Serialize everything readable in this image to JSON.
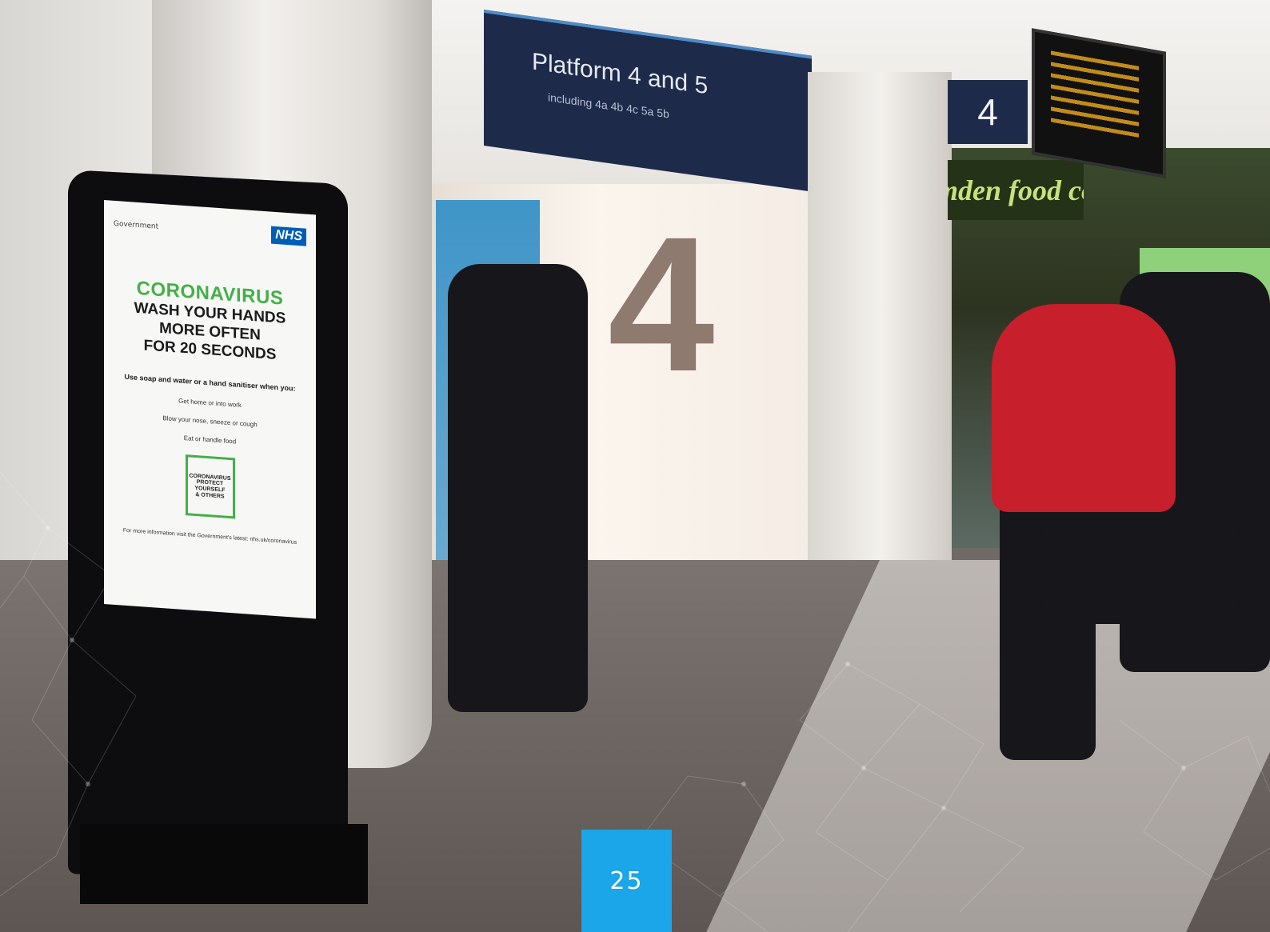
{
  "photo": {
    "platform_sign": {
      "title": "Platform 4 and 5",
      "subtitle": "including 4a 4b 4c 5a 5b"
    },
    "wall_number": "4",
    "platform_box_number": "4",
    "shop_sign": "mden food co"
  },
  "kiosk_screen": {
    "gov_mark": "Government",
    "nhs_logo": "NHS",
    "title": "CORONAVIRUS",
    "headline": [
      "WASH YOUR HANDS",
      "MORE OFTEN",
      "FOR 20 SECONDS"
    ],
    "use_soap": "Use soap and water or a hand sanitiser when you:",
    "when_items": [
      "Get home or into work",
      "Blow your nose, sneeze or cough",
      "Eat or handle food"
    ],
    "protect_lines": [
      "CORONAVIRUS",
      "PROTECT",
      "YOURSELF",
      "& OTHERS"
    ],
    "footer_note": "For more information visit the Government's latest: nhs.uk/coronavirus"
  },
  "page_number": "25",
  "colors": {
    "page_badge": "#1aa6e8",
    "corona_green": "#44b049",
    "nhs_blue": "#005eb8"
  }
}
